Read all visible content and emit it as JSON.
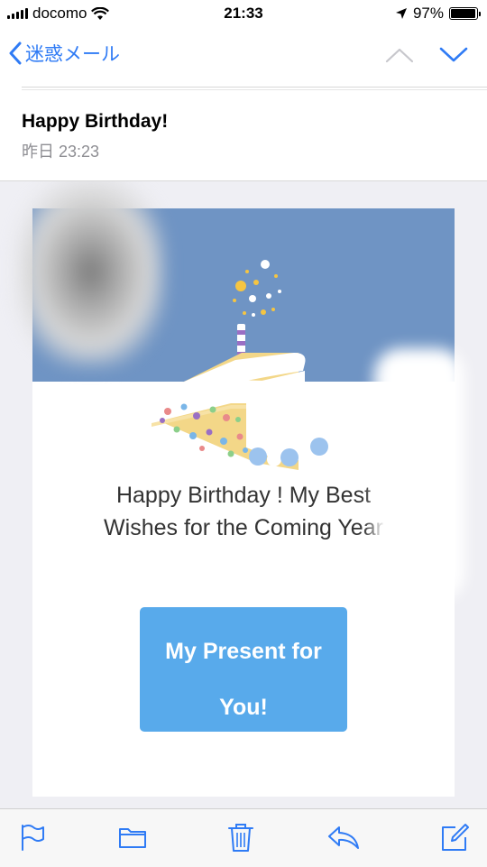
{
  "status_bar": {
    "carrier": "docomo",
    "time": "21:33",
    "battery_percent": "97%",
    "battery_level": 0.97
  },
  "nav": {
    "back_label": "迷惑メール",
    "accent_color": "#2f7bf5"
  },
  "message": {
    "subject": "Happy Birthday!",
    "date": "昨日 23:23"
  },
  "email_content": {
    "greeting_line1": "Happy Birthday ! My Best",
    "greeting_line2": "Wishes for the Coming Year",
    "button_line1": "My Present for",
    "button_line2": "You!",
    "button_color": "#58aaeb",
    "banner_color": "#6f94c4"
  },
  "toolbar": {
    "icons": [
      "flag-icon",
      "folder-icon",
      "trash-icon",
      "reply-icon",
      "compose-icon"
    ]
  }
}
